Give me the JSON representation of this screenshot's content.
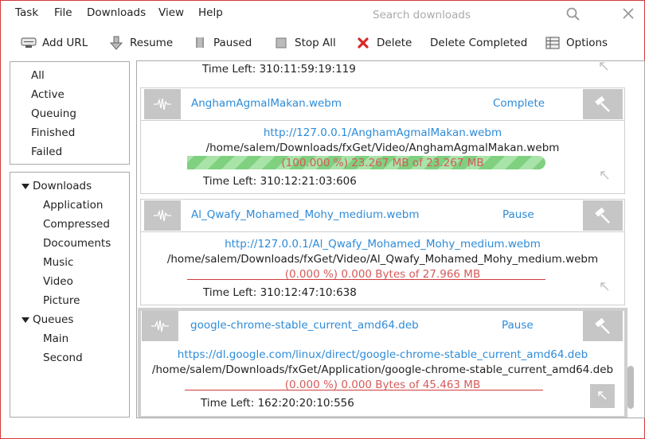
{
  "menu": [
    "Task",
    "File",
    "Downloads",
    "View",
    "Help"
  ],
  "search": {
    "placeholder": "Search downloads",
    "value": ""
  },
  "toolbar": {
    "add_url": "Add URL",
    "resume": "Resume",
    "paused": "Paused",
    "stop_all": "Stop All",
    "delete": "Delete",
    "delete_completed": "Delete Completed",
    "options": "Options"
  },
  "status_filters": [
    "All",
    "Active",
    "Queuing",
    "Finished",
    "Failed"
  ],
  "tree": {
    "downloads_label": "Downloads",
    "categories": [
      "Application",
      "Compressed",
      "Docouments",
      "Music",
      "Video",
      "Picture"
    ],
    "queues_label": "Queues",
    "queues": [
      "Main",
      "Second"
    ]
  },
  "partial_top": {
    "time_left": "Time Left: 310:11:59:19:119"
  },
  "downloads": [
    {
      "name": "AnghamAgmalMakan.webm",
      "status": "Complete",
      "url": "http://127.0.0.1/AnghamAgmalMakan.webm",
      "path": "/home/salem/Downloads/fxGet/Video/AnghamAgmalMakan.webm",
      "progress_text": "(100.000 %) 23.267 MB of 23.267 MB",
      "progress": 1.0,
      "time_left": "Time Left: 310:12:21:03:606"
    },
    {
      "name": "Al_Qwafy_Mohamed_Mohy_medium.webm",
      "status": "Pause",
      "url": "http://127.0.0.1/Al_Qwafy_Mohamed_Mohy_medium.webm",
      "path": "/home/salem/Downloads/fxGet/Video/Al_Qwafy_Mohamed_Mohy_medium.webm",
      "progress_text": "(0.000 %) 0.000 Bytes of 27.966 MB",
      "progress": 0.0,
      "time_left": "Time Left: 310:12:47:10:638"
    },
    {
      "name": "google-chrome-stable_current_amd64.deb",
      "status": "Pause",
      "url": "https://dl.google.com/linux/direct/google-chrome-stable_current_amd64.deb",
      "path": "/home/salem/Downloads/fxGet/Application/google-chrome-stable_current_amd64.deb",
      "progress_text": "(0.000 %) 0.000 Bytes of 45.463 MB",
      "progress": 0.0,
      "time_left": "Time Left: 162:20:20:10:556"
    }
  ],
  "colors": {
    "link": "#2e8bd8",
    "progress_text": "#d65a5a",
    "progress_fill": "#7fd07f",
    "frame": "#d23a3a"
  }
}
